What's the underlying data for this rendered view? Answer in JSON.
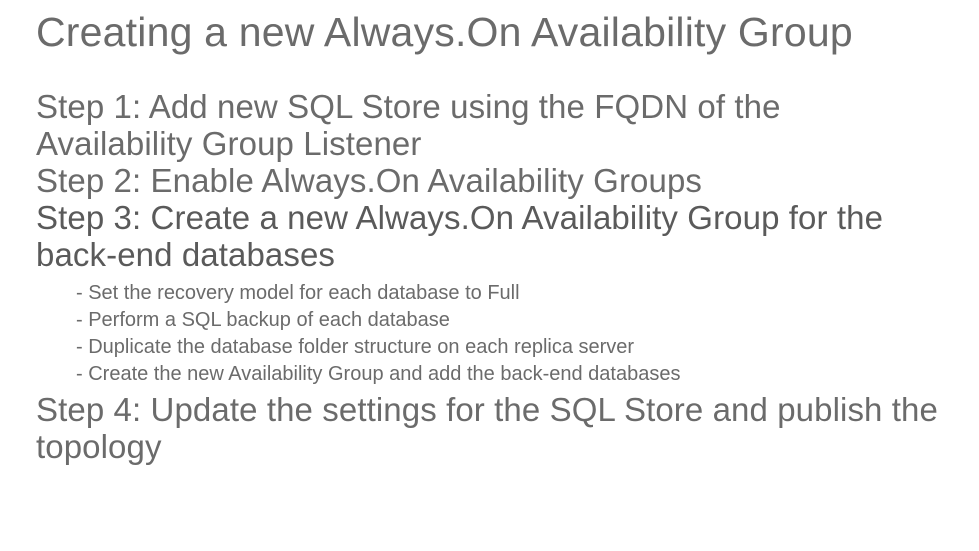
{
  "title": "Creating a new Always.On Availability Group",
  "steps": {
    "s1": "Step 1: Add new SQL Store using the FQDN of the Availability Group Listener",
    "s2": "Step 2:  Enable Always.On Availability Groups",
    "s3": "Step 3: Create a new Always.On Availability Group for the back-end databases",
    "s4": "Step 4: Update the settings for the SQL Store and publish the topology"
  },
  "sub": {
    "a": "- Set the recovery model for each database to Full",
    "b": "- Perform a SQL backup of each database",
    "c": "- Duplicate the database folder structure on each replica server",
    "d": "- Create the new Availability Group and add the back-end databases"
  }
}
